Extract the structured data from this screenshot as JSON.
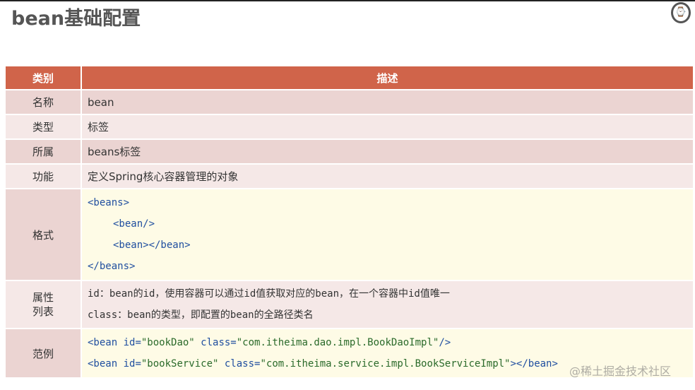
{
  "title": "bean基础配置",
  "header": {
    "col1": "类别",
    "col2": "描述"
  },
  "rows": [
    {
      "label": "名称",
      "value": "bean"
    },
    {
      "label": "类型",
      "value": "标签"
    },
    {
      "label": "所属",
      "value": "beans标签"
    },
    {
      "label": "功能",
      "value": "定义Spring核心容器管理的对象"
    }
  ],
  "format": {
    "label": "格式",
    "lines": [
      "<beans>",
      "<bean/>",
      "<bean></bean>",
      "</beans>"
    ]
  },
  "attrs": {
    "label": "属性\n列表",
    "lines": [
      "id：bean的id，使用容器可以通过id值获取对应的bean，在一个容器中id值唯一",
      "class：bean的类型，即配置的bean的全路径类名"
    ]
  },
  "example": {
    "label": "范例",
    "lines": [
      [
        "<bean",
        " id=",
        "\"bookDao\"",
        " class=",
        "\"com.itheima.dao.impl.BookDaoImpl\"",
        "/>"
      ],
      [
        "<bean",
        " id=",
        "\"bookService\"",
        " class=",
        "\"com.itheima.service.impl.BookServiceImpl\"",
        "></bean>"
      ]
    ]
  },
  "watermark": "@稀土掘金技术社区"
}
